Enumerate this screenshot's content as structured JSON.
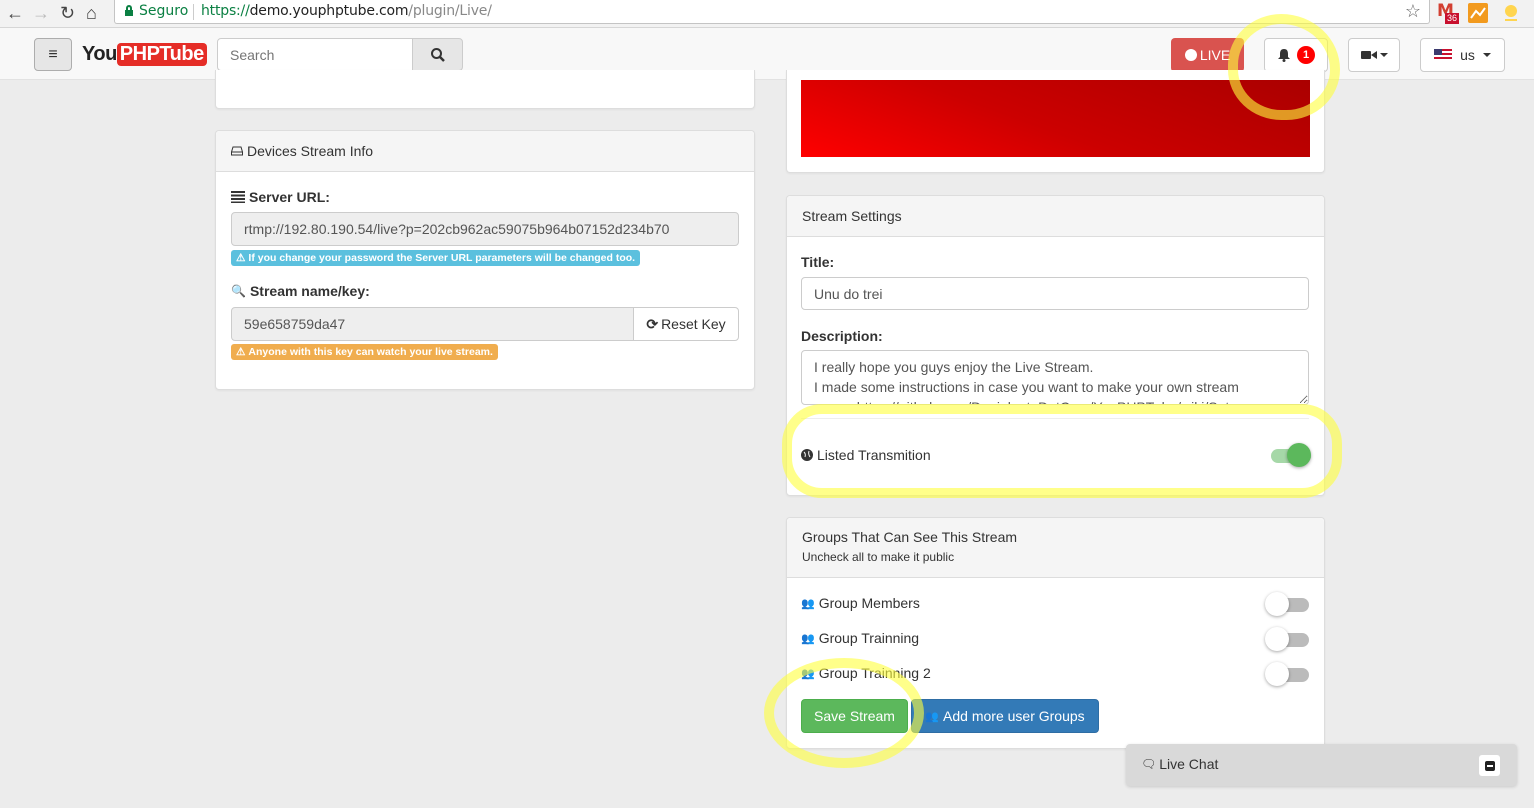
{
  "browser": {
    "security_label": "Seguro",
    "url_scheme": "https://",
    "url_host": "demo.youphptube.com",
    "url_path": "/plugin/Live/",
    "gmail_count": "36"
  },
  "navbar": {
    "logo_you": "You",
    "logo_phptube": "PHPTube",
    "search_placeholder": "Search",
    "live_label": "LIVE",
    "notification_count": "1",
    "language_label": "us"
  },
  "devices_panel": {
    "heading": "Devices Stream Info",
    "server_url_label": "Server URL:",
    "server_url_value": "rtmp://192.80.190.54/live?p=202cb962ac59075b964b07152d234b70",
    "server_url_note": "If you change your password the Server URL parameters will be changed too.",
    "stream_key_label": "Stream name/key:",
    "stream_key_value": "59e658759da47",
    "reset_key_label": "Reset Key",
    "stream_key_note": "Anyone with this key can watch your live stream."
  },
  "stream_settings": {
    "heading": "Stream Settings",
    "title_label": "Title:",
    "title_value": "Unu do trei",
    "description_label": "Description:",
    "description_value": "I really hope you guys enjoy the Live Stream.\nI made some instructions in case you want to make your own stream\nserver https://github.com/DanielnetoDotCom/YouPHPTube/wiki/Set...",
    "listed_label": "Listed Transmition",
    "listed_on": true
  },
  "groups_panel": {
    "heading": "Groups That Can See This Stream",
    "subheading": "Uncheck all to make it public",
    "groups": [
      {
        "label": "Group Members",
        "enabled": false
      },
      {
        "label": "Group Trainning",
        "enabled": false
      },
      {
        "label": "Group Trainning 2",
        "enabled": false
      }
    ],
    "save_label": "Save Stream",
    "add_groups_label": "Add more user Groups"
  },
  "chat": {
    "label": "Live Chat"
  },
  "colors": {
    "brand_red": "#e52d27",
    "live_red": "#d9534f",
    "success_green": "#5cb85c",
    "primary_blue": "#337ab7",
    "info_cyan": "#5bc0de",
    "warning_orange": "#f0ad4e"
  }
}
